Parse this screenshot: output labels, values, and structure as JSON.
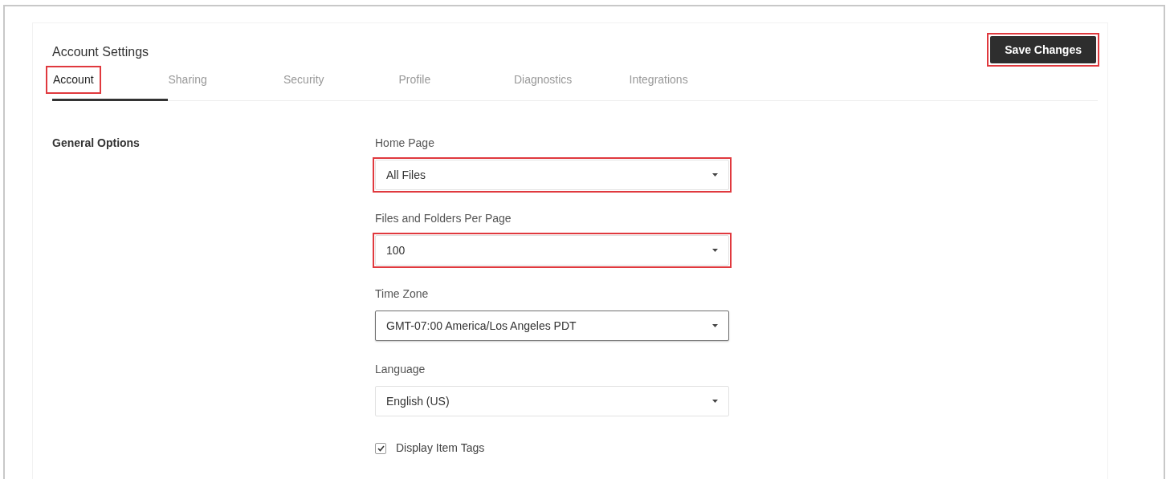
{
  "header": {
    "title": "Account Settings",
    "save_button": {
      "label": "Save Changes",
      "highlighted": true
    }
  },
  "tabs": [
    {
      "label": "Account",
      "selected": true,
      "highlighted": true
    },
    {
      "label": "Sharing",
      "selected": false,
      "highlighted": false
    },
    {
      "label": "Security",
      "selected": false,
      "highlighted": false
    },
    {
      "label": "Profile",
      "selected": false,
      "highlighted": false
    },
    {
      "label": "Diagnostics",
      "selected": false,
      "highlighted": false
    },
    {
      "label": "Integrations",
      "selected": false,
      "highlighted": false
    }
  ],
  "section": {
    "title": "General Options",
    "fields": [
      {
        "kind": "select",
        "label": "Home Page",
        "value": "All Files",
        "highlighted": true,
        "focused": false
      },
      {
        "kind": "select",
        "label": "Files and Folders Per Page",
        "value": "100",
        "highlighted": true,
        "focused": false
      },
      {
        "kind": "select",
        "label": "Time Zone",
        "value": "GMT-07:00 America/Los Angeles PDT",
        "highlighted": false,
        "focused": true
      },
      {
        "kind": "select",
        "label": "Language",
        "value": "English (US)",
        "highlighted": false,
        "focused": false
      },
      {
        "kind": "checkbox",
        "label": "Display Item Tags",
        "checked": true
      }
    ]
  }
}
